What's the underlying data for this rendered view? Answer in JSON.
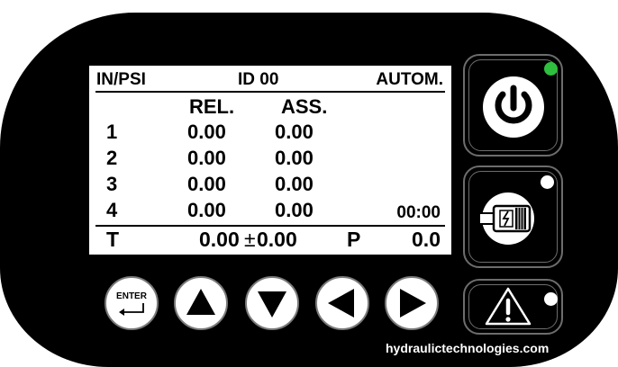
{
  "display": {
    "unit": "IN/PSI",
    "id_label": "ID 00",
    "mode": "AUTOM.",
    "col_rel": "REL.",
    "col_ass": "ASS.",
    "rows": [
      {
        "n": "1",
        "rel": "0.00",
        "ass": "0.00"
      },
      {
        "n": "2",
        "rel": "0.00",
        "ass": "0.00"
      },
      {
        "n": "3",
        "rel": "0.00",
        "ass": "0.00"
      },
      {
        "n": "4",
        "rel": "0.00",
        "ass": "0.00"
      }
    ],
    "time": "00:00",
    "t_label": "T",
    "t_value": "0.00",
    "t_pm": "±",
    "t_dev": "0.00",
    "p_label": "P",
    "p_value": "0.0"
  },
  "buttons": {
    "enter_label": "ENTER",
    "power_icon": "power-icon",
    "motor_icon": "motor-icon",
    "warning_icon": "warning-icon"
  },
  "leds": {
    "power": "#2fbf3f",
    "motor": "#ffffff",
    "warning": "#ffffff"
  },
  "footer": {
    "website": "hydraulictechnologies.com"
  }
}
